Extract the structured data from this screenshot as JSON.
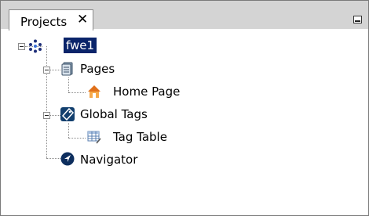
{
  "panel": {
    "tab_title": "Projects",
    "close_glyph": "✕"
  },
  "tree": {
    "root": {
      "label": "fwe1",
      "icon": "project-network-icon",
      "selected": true
    },
    "pages": {
      "label": "Pages",
      "icon": "pages-icon"
    },
    "home_page": {
      "label": "Home Page",
      "icon": "home-icon"
    },
    "global_tags": {
      "label": "Global Tags",
      "icon": "tag-icon"
    },
    "tag_table": {
      "label": "Tag Table",
      "icon": "table-icon"
    },
    "navigator": {
      "label": "Navigator",
      "icon": "navigator-icon"
    }
  },
  "colors": {
    "selection_bg": "#0a246a",
    "selection_fg": "#ffffff",
    "tabstrip_bg": "#d4d4d4"
  }
}
